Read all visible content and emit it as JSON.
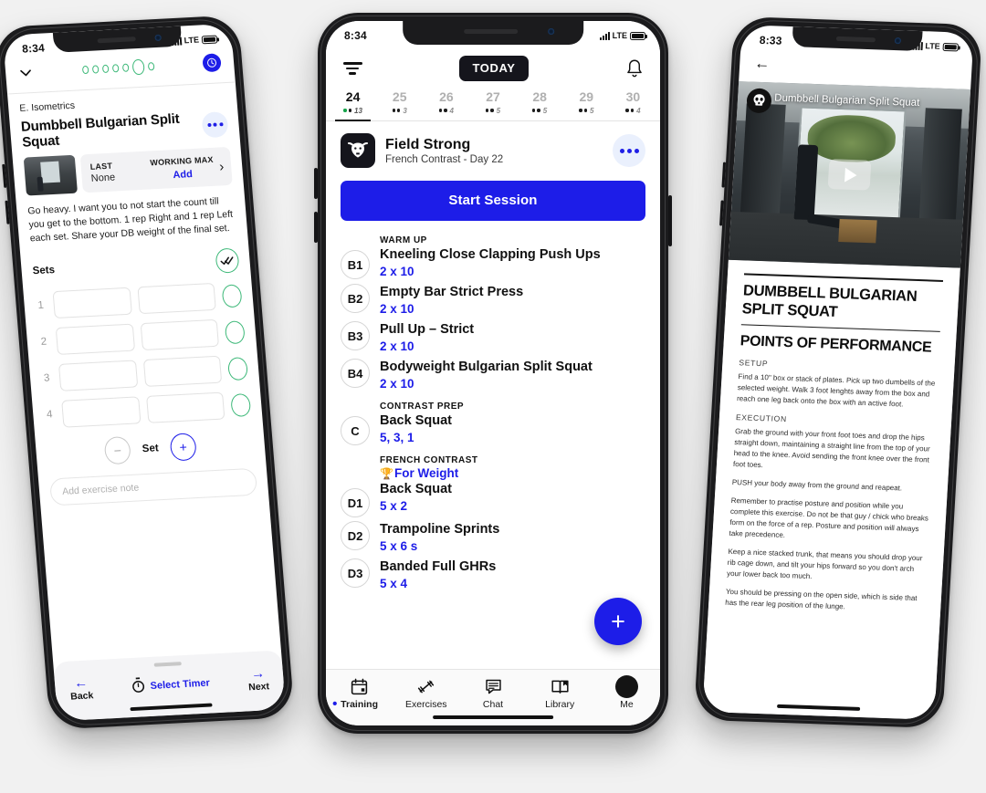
{
  "background_color": "#f1f1f1",
  "accent_blue": "#1d1de8",
  "accent_green": "#3cb878",
  "highlight_yellow": "#f2f24a",
  "left_phone": {
    "status": {
      "time": "8:34",
      "carrier": "LTE"
    },
    "header": {
      "collapse_icon": "chevron-down-icon",
      "progress_dots": 7,
      "progress_active_index": 5,
      "timer_icon": "clock-icon"
    },
    "kicker": "E. Isometrics",
    "title": "Dumbbell Bulgarian Split Squat",
    "more_icon": "ellipsis-icon",
    "stats": {
      "last_label": "LAST",
      "last_value": "None",
      "working_max_label": "WORKING MAX",
      "add_label": "Add",
      "chevron": "›"
    },
    "note": "Go heavy. I want you to not start the count till you get to the bottom. 1 rep Right and 1 rep Left each set. Share your DB weight of the final set.",
    "sets_label": "Sets",
    "set_rows": [
      "1",
      "2",
      "3",
      "4"
    ],
    "set_control": {
      "minus": "−",
      "label": "Set",
      "plus": "+"
    },
    "note_placeholder": "Add exercise note",
    "footer": {
      "back_label": "Back",
      "back_arrow": "←",
      "timer_label": "Select Timer",
      "timer_icon": "stopwatch-icon",
      "next_label": "Next",
      "next_arrow": "→"
    }
  },
  "mid_phone": {
    "status": {
      "time": "8:34",
      "carrier": "LTE"
    },
    "nav": {
      "filter_icon": "filter-icon",
      "today_label": "TODAY",
      "bell_icon": "bell-icon"
    },
    "days": [
      {
        "num": "24",
        "count": "13",
        "active": true
      },
      {
        "num": "25",
        "count": "3",
        "active": false
      },
      {
        "num": "26",
        "count": "4",
        "active": false
      },
      {
        "num": "27",
        "count": "5",
        "active": false
      },
      {
        "num": "28",
        "count": "5",
        "active": false
      },
      {
        "num": "29",
        "count": "5",
        "active": false
      },
      {
        "num": "30",
        "count": "4",
        "active": false
      }
    ],
    "program": {
      "logo_icon": "bull-logo-icon",
      "name": "Field Strong",
      "subtitle": "French Contrast - Day 22",
      "more_icon": "ellipsis-icon"
    },
    "start_button": "Start Session",
    "exercises": [
      {
        "badge": "B1",
        "section": "WARM UP",
        "goal": "",
        "name": "Kneeling Close Clapping Push Ups",
        "sets": "2 x 10"
      },
      {
        "badge": "B2",
        "section": "",
        "goal": "",
        "name": "Empty Bar Strict Press",
        "sets": "2 x 10"
      },
      {
        "badge": "B3",
        "section": "",
        "goal": "",
        "name": "Pull Up – Strict",
        "sets": "2 x 10"
      },
      {
        "badge": "B4",
        "section": "",
        "goal": "",
        "name": "Bodyweight Bulgarian Split Squat",
        "sets": "2 x 10"
      },
      {
        "badge": "C",
        "section": "CONTRAST PREP",
        "goal": "",
        "name": "Back Squat",
        "sets": "5, 3, 1"
      },
      {
        "badge": "D1",
        "section": "FRENCH CONTRAST",
        "goal": "For Weight",
        "name": "Back Squat",
        "sets": "5 x 2"
      },
      {
        "badge": "D2",
        "section": "",
        "goal": "",
        "name": "Trampoline Sprints",
        "sets": "5 x 6 s"
      },
      {
        "badge": "D3",
        "section": "",
        "goal": "",
        "name": "Banded Full GHRs",
        "sets": "5 x 4"
      }
    ],
    "fab_label": "+",
    "tabs": [
      {
        "label": "Training",
        "icon": "calendar-icon",
        "active": true
      },
      {
        "label": "Exercises",
        "icon": "barbell-icon",
        "active": false
      },
      {
        "label": "Chat",
        "icon": "chat-icon",
        "active": false
      },
      {
        "label": "Library",
        "icon": "book-icon",
        "active": false
      },
      {
        "label": "Me",
        "icon": "avatar-icon",
        "active": false
      }
    ]
  },
  "right_phone": {
    "status": {
      "time": "8:33",
      "carrier": "LTE"
    },
    "back_icon": "back-arrow-icon",
    "video": {
      "badge_icon": "skull-logo-icon",
      "title": "Dumbbell Bulgarian Split Squat",
      "play_icon": "play-icon"
    },
    "doc": {
      "title_line1": "DUMBBELL BULGARIAN",
      "title_line2": "SPLIT SQUAT",
      "subtitle": "POINTS OF PERFORMANCE",
      "sections": [
        {
          "heading": "SETUP",
          "paragraphs": [
            "Find a 10\" box or stack of plates. Pick up two dumbells of the selected weight. Walk 3 foot lenghts away from the box and reach one leg back onto the box with an active foot."
          ]
        },
        {
          "heading": "EXECUTION",
          "paragraphs": [
            "Grab the ground with your front foot toes and drop the hips straight down, maintaining a straight line from the top of your head to the knee. Avoid sending the front knee over the front foot toes.",
            "PUSH your body away from the ground and reapeat.",
            "Remember to practise posture and position while you complete this exercise. Do not be that guy / chick who breaks form on the force of a rep. Posture and position will always take precedence.",
            "Keep a nice stacked trunk, that means you should drop your rib cage down, and tilt your hips forward so you don't arch your lower back too much.",
            "You should be pressing on the open side, which is side that has the rear leg position of the lunge."
          ]
        }
      ]
    }
  }
}
